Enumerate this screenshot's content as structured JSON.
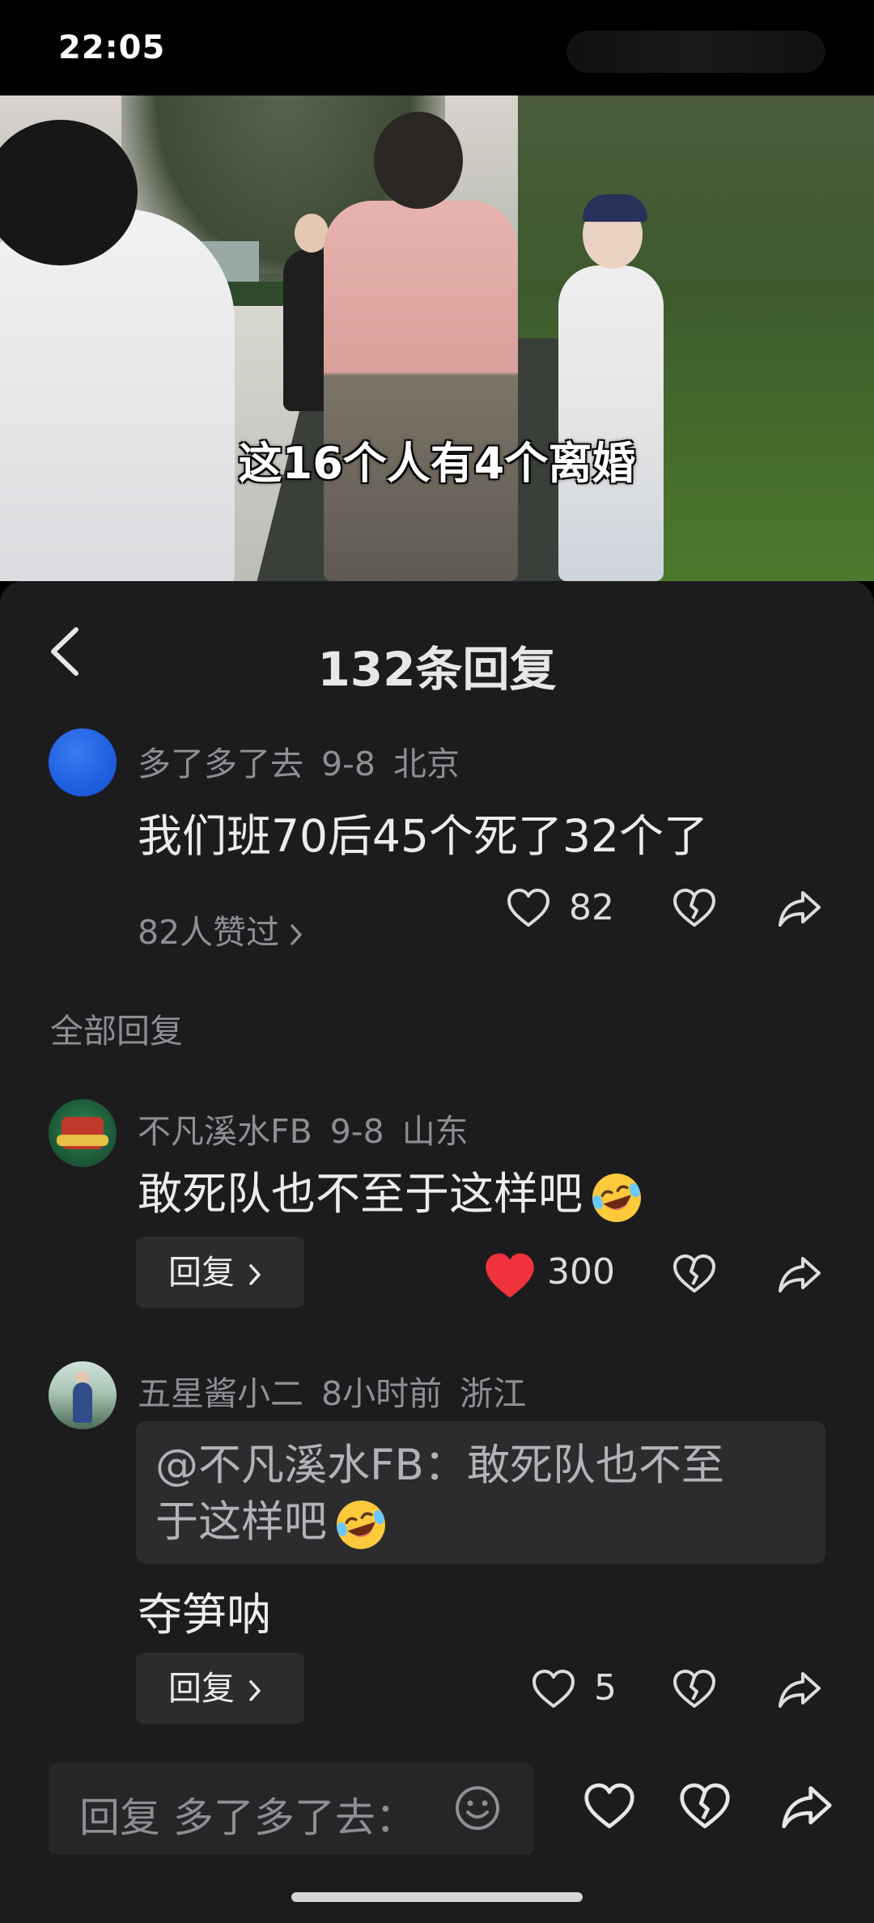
{
  "status_bar": {
    "time": "22:05"
  },
  "video": {
    "subtitle": "这16个人有4个离婚"
  },
  "header": {
    "title": "132条回复"
  },
  "main_comment": {
    "username": "多了多了去",
    "date": "9-8",
    "location": "北京",
    "text": "我们班70后45个死了32个了",
    "likes_summary": "82人赞过",
    "like_count": "82"
  },
  "section_label": "全部回复",
  "replies": [
    {
      "username": "不凡溪水FB",
      "date": "9-8",
      "location": "山东",
      "text": "敢死队也不至于这样吧",
      "emoji": "laughing-face",
      "reply_label": "回复",
      "like_count": "300",
      "liked": true
    },
    {
      "username": "五星酱小二",
      "date": "8小时前",
      "location": "浙江",
      "quote_line1": "@不凡溪水FB：敢死队也不至",
      "quote_line2": "于这样吧",
      "text": "夺笋呐",
      "reply_label": "回复",
      "like_count": "5",
      "liked": false
    }
  ],
  "input_bar": {
    "placeholder": "回复 多了多了去："
  },
  "colors": {
    "sheet_bg": "#1c1c1e",
    "liked_heart": "#f0323c",
    "secondary_text": "#8e8e93",
    "avatar_blue": "#2a6ef0"
  }
}
